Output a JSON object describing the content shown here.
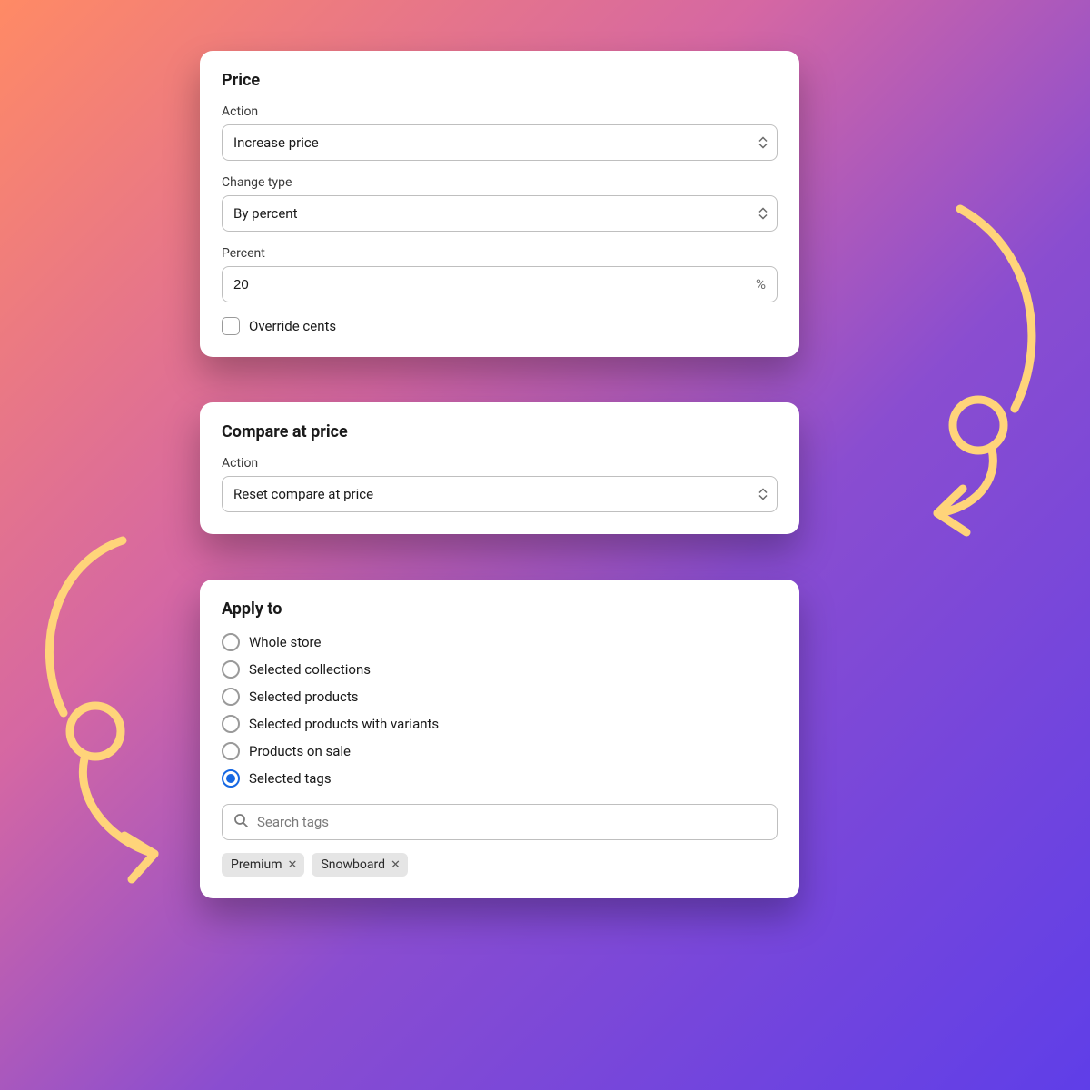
{
  "colors": {
    "accent_arrow": "#ffd47a"
  },
  "price": {
    "title": "Price",
    "action_label": "Action",
    "action_value": "Increase price",
    "change_type_label": "Change type",
    "change_type_value": "By percent",
    "percent_label": "Percent",
    "percent_value": "20",
    "percent_suffix": "%",
    "override_cents_label": "Override cents",
    "override_cents_checked": false
  },
  "compare": {
    "title": "Compare at price",
    "action_label": "Action",
    "action_value": "Reset compare at price"
  },
  "apply": {
    "title": "Apply to",
    "options": [
      {
        "label": "Whole store",
        "selected": false
      },
      {
        "label": "Selected collections",
        "selected": false
      },
      {
        "label": "Selected products",
        "selected": false
      },
      {
        "label": "Selected products with variants",
        "selected": false
      },
      {
        "label": "Products on sale",
        "selected": false
      },
      {
        "label": "Selected tags",
        "selected": true
      }
    ],
    "search_placeholder": "Search tags",
    "tags": [
      "Premium",
      "Snowboard"
    ]
  }
}
